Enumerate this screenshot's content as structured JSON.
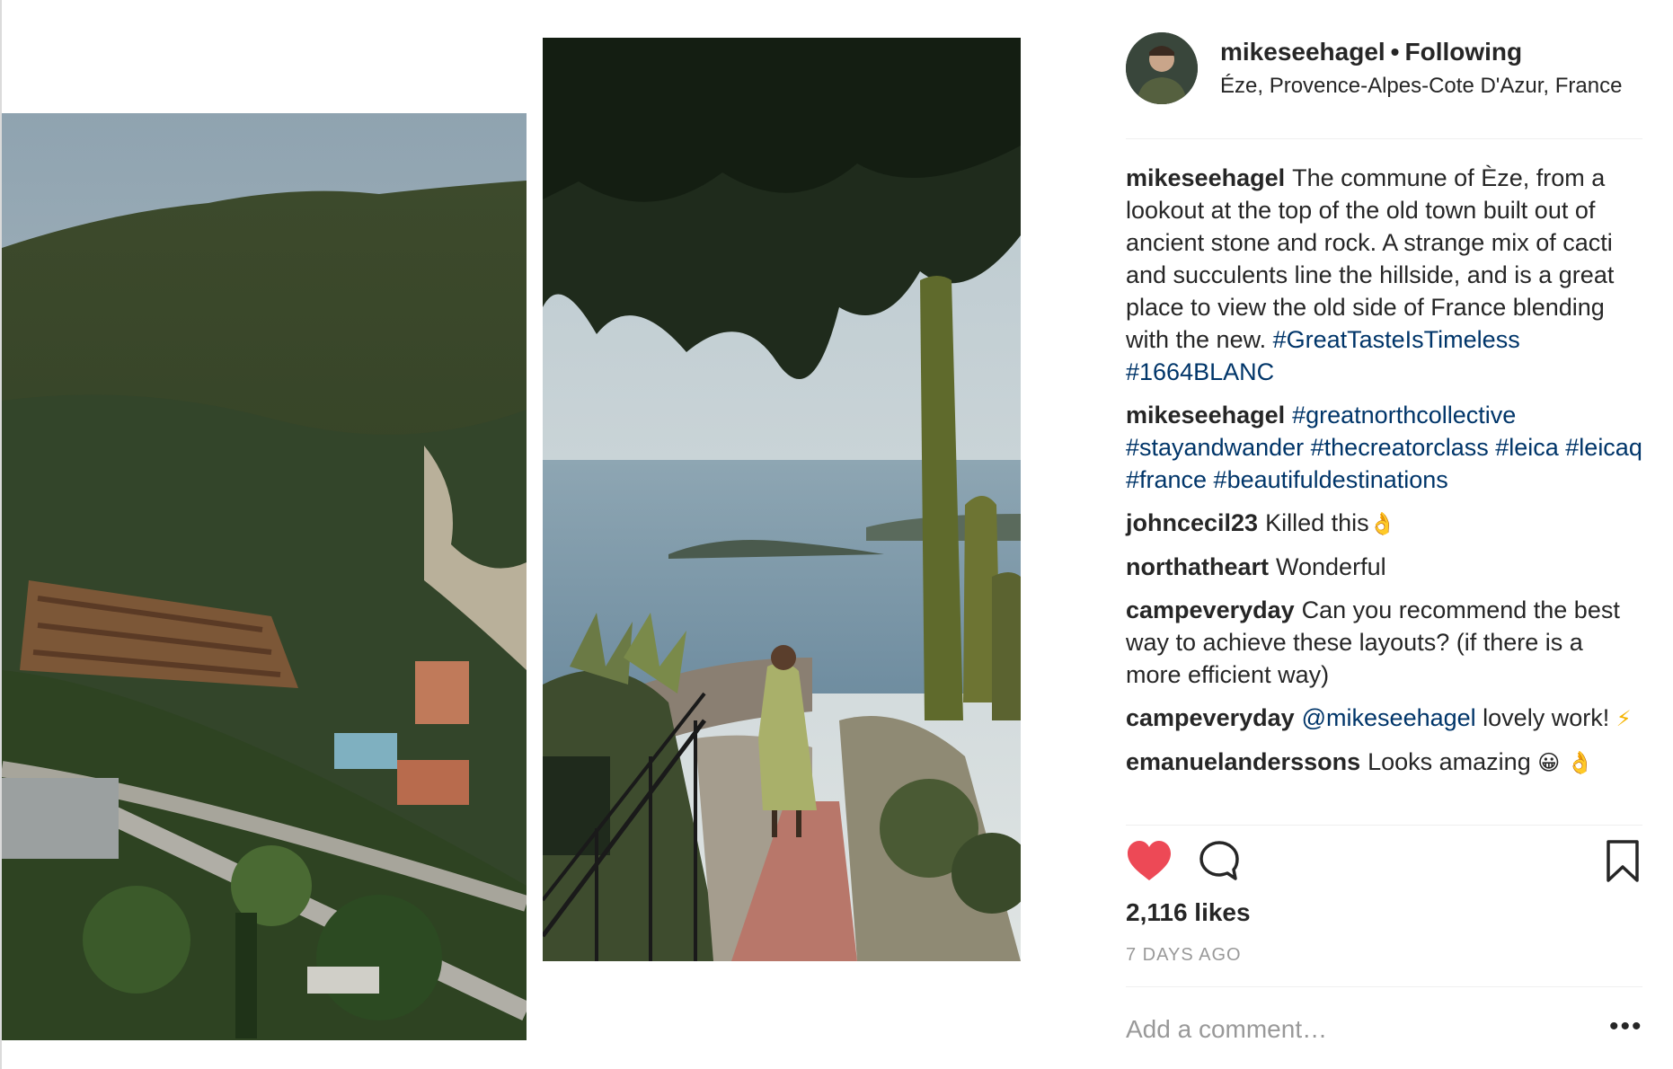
{
  "post": {
    "username": "mikeseehagel",
    "separator": "•",
    "follow_status": "Following",
    "location": "Éze, Provence-Alpes-Cote D'Azur, France",
    "avatar_icon": "avatar-photo"
  },
  "comments": [
    {
      "user": "mikeseehagel",
      "text": "The commune of Èze, from a lookout at the top of the old town built out of ancient stone and rock. A strange mix of cacti and succulents line the hillside, and is a great place to view the old side of France blending with the new.",
      "tags": "#GreatTasteIsTimeless #1664BLANC"
    },
    {
      "user": "mikeseehagel",
      "tags": "#greatnorthcollective #stayandwander #thecreatorclass #leica #leicaq #france #beautifuldestinations"
    },
    {
      "user": "johncecil23",
      "text": "Killed this",
      "emoji": "👌"
    },
    {
      "user": "northatheart",
      "text": "Wonderful"
    },
    {
      "user": "campeveryday",
      "text": "Can you recommend the best way to achieve these layouts? (if there is a more efficient way)"
    },
    {
      "user": "campeveryday",
      "mention": "@mikeseehagel",
      "text": "lovely work!",
      "emoji": "⚡"
    },
    {
      "user": "emanuelanderssons",
      "text": "Looks amazing",
      "emoji": "😀 👌"
    }
  ],
  "actions": {
    "like_icon": "heart-icon",
    "comment_icon": "comment-icon",
    "save_icon": "bookmark-icon",
    "like_color": "#ed4956"
  },
  "likes": "2,116 likes",
  "time_ago": "7 DAYS AGO",
  "add_comment_placeholder": "Add a comment…",
  "more_label": "•••"
}
